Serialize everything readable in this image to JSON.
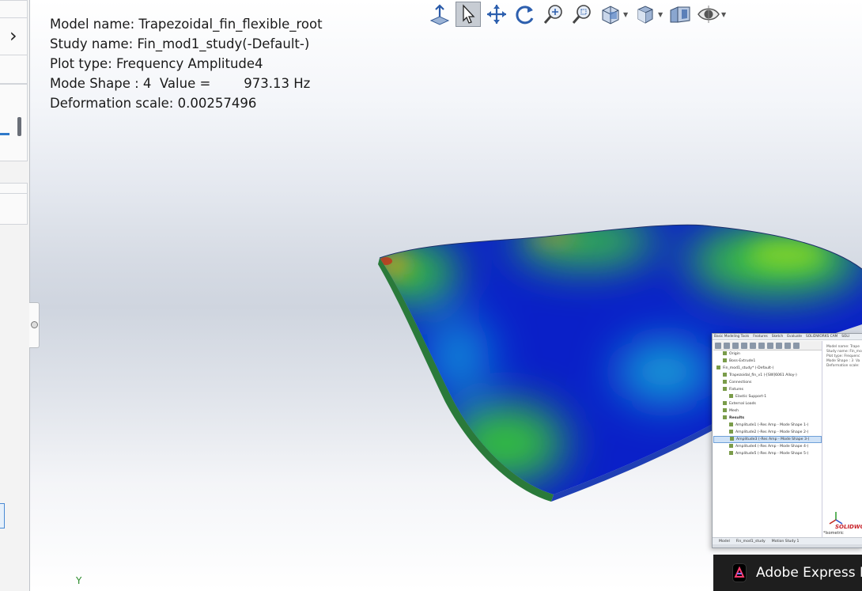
{
  "info": {
    "model_name": "Model name: Trapezoidal_fin_flexible_root",
    "study_name": "Study name: Fin_mod1_study(-Default-)",
    "plot_type": "Plot type: Frequency Amplitude4",
    "mode_shape": "Mode Shape : 4  Value =        973.13 Hz",
    "deformation_scale": "Deformation scale: 0.00257496"
  },
  "toolbar": {
    "icons": [
      "normal-to-icon",
      "select-arrow-icon",
      "pan-icon",
      "rotate-icon",
      "zoom-to-fit-icon",
      "zoom-to-area-icon",
      "section-view-icon",
      "display-style-icon",
      "view-orientation-icon",
      "hide-show-icon"
    ],
    "active_icon": "select-arrow-icon"
  },
  "axis": {
    "y_label": "Y"
  },
  "colors": {
    "accent": "#2f79c9",
    "background_top": "#ffffff",
    "background_mid": "#cfd5df"
  },
  "thumbnail": {
    "tabs": [
      "Basic Modeling Tools",
      "Features",
      "Sketch",
      "Evaluate",
      "SOLIDWORKS CAM",
      "SOLI"
    ],
    "tree": [
      {
        "label": "Origin",
        "indent": 1
      },
      {
        "label": "Boss-Extrude1",
        "indent": 1
      },
      {
        "label": "Fin_mod1_study* (-Default-)",
        "indent": 0
      },
      {
        "label": "Trapezoidal_fin_v1 (-[SW]6061 Alloy-)",
        "indent": 1
      },
      {
        "label": "Connections",
        "indent": 1
      },
      {
        "label": "Fixtures",
        "indent": 1
      },
      {
        "label": "Elastic Support-1",
        "indent": 2
      },
      {
        "label": "External Loads",
        "indent": 1
      },
      {
        "label": "Mesh",
        "indent": 1
      },
      {
        "label": "Results",
        "indent": 1,
        "bold": true
      },
      {
        "label": "Amplitude1 (-Res Amp - Mode Shape 1-)",
        "indent": 2
      },
      {
        "label": "Amplitude2 (-Res Amp - Mode Shape 2-)",
        "indent": 2
      },
      {
        "label": "Amplitude3 (-Res Amp - Mode Shape 3-)",
        "indent": 2,
        "selected": true
      },
      {
        "label": "Amplitude4 (-Res Amp - Mode Shape 4-)",
        "indent": 2
      },
      {
        "label": "Amplitude5 (-Res Amp - Mode Shape 5-)",
        "indent": 2
      }
    ],
    "info_lines": "Model name: Trape\nStudy name: Fin_mo\nPlot type: Frequenc\nMode Shape : 3  Va\nDeformation scale:",
    "bottom_tabs": [
      "Model",
      "Fin_mod1_study",
      "Motion Study 1"
    ],
    "view_label": "*Isometric",
    "watermark": "SOLIDWOR"
  },
  "taskbar": {
    "label": "Adobe Express P"
  }
}
